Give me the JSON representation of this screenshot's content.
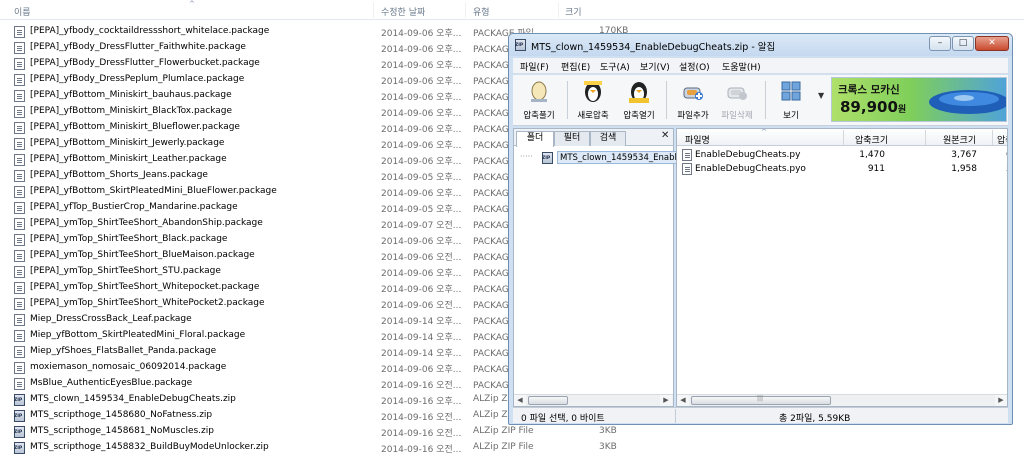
{
  "explorer": {
    "columns": {
      "name": "이름",
      "modified": "수정한 날짜",
      "type": "유형",
      "size": "크기"
    },
    "files": [
      {
        "name": "[PEPA]_yfbody_cocktaildressshort_whitelace.package",
        "date": "2014-09-06 오후...",
        "type": "PACKAGE 파일",
        "size": "170KB",
        "icon": "document-icon"
      },
      {
        "name": "[PEPA]_yfBody_DressFlutter_Faithwhite.package",
        "date": "2014-09-06 오후...",
        "type": "PACKAGE 파일",
        "size": "",
        "icon": "document-icon"
      },
      {
        "name": "[PEPA]_yfBody_DressFlutter_Flowerbucket.package",
        "date": "2014-09-06 오후...",
        "type": "PACKAGE 파일",
        "size": "",
        "icon": "document-icon"
      },
      {
        "name": "[PEPA]_yfBody_DressPeplum_Plumlace.package",
        "date": "2014-09-06 오후...",
        "type": "PACKAGE 파일",
        "size": "",
        "icon": "document-icon"
      },
      {
        "name": "[PEPA]_yfBottom_Miniskirt_bauhaus.package",
        "date": "2014-09-06 오후...",
        "type": "PACKAGE 파일",
        "size": "",
        "icon": "document-icon"
      },
      {
        "name": "[PEPA]_yfBottom_Miniskirt_BlackTox.package",
        "date": "2014-09-06 오후...",
        "type": "PACKAGE 파일",
        "size": "",
        "icon": "document-icon"
      },
      {
        "name": "[PEPA]_yfBottom_Miniskirt_Blueflower.package",
        "date": "2014-09-06 오후...",
        "type": "PACKAGE 파일",
        "size": "",
        "icon": "document-icon"
      },
      {
        "name": "[PEPA]_yfBottom_Miniskirt_Jewerly.package",
        "date": "2014-09-06 오후...",
        "type": "PACKAGE 파일",
        "size": "",
        "icon": "document-icon"
      },
      {
        "name": "[PEPA]_yfBottom_Miniskirt_Leather.package",
        "date": "2014-09-06 오후...",
        "type": "PACKAGE 파일",
        "size": "",
        "icon": "document-icon"
      },
      {
        "name": "[PEPA]_yfBottom_Shorts_Jeans.package",
        "date": "2014-09-05 오후...",
        "type": "PACKAGE 파일",
        "size": "",
        "icon": "document-icon"
      },
      {
        "name": "[PEPA]_yfBottom_SkirtPleatedMini_BlueFlower.package",
        "date": "2014-09-06 오후...",
        "type": "PACKAGE 파일",
        "size": "",
        "icon": "document-icon"
      },
      {
        "name": "[PEPA]_yfTop_BustierCrop_Mandarine.package",
        "date": "2014-09-05 오후...",
        "type": "PACKAGE 파일",
        "size": "",
        "icon": "document-icon"
      },
      {
        "name": "[PEPA]_ymTop_ShirtTeeShort_AbandonShip.package",
        "date": "2014-09-07 오전...",
        "type": "PACKAGE 파일",
        "size": "",
        "icon": "document-icon"
      },
      {
        "name": "[PEPA]_ymTop_ShirtTeeShort_Black.package",
        "date": "2014-09-06 오후...",
        "type": "PACKAGE 파일",
        "size": "",
        "icon": "document-icon"
      },
      {
        "name": "[PEPA]_ymTop_ShirtTeeShort_BlueMaison.package",
        "date": "2014-09-06 오전...",
        "type": "PACKAGE 파일",
        "size": "",
        "icon": "document-icon"
      },
      {
        "name": "[PEPA]_ymTop_ShirtTeeShort_STU.package",
        "date": "2014-09-06 오후...",
        "type": "PACKAGE 파일",
        "size": "",
        "icon": "document-icon"
      },
      {
        "name": "[PEPA]_ymTop_ShirtTeeShort_Whitepocket.package",
        "date": "2014-09-06 오후...",
        "type": "PACKAGE 파일",
        "size": "",
        "icon": "document-icon"
      },
      {
        "name": "[PEPA]_ymTop_ShirtTeeShort_WhitePocket2.package",
        "date": "2014-09-06 오전...",
        "type": "PACKAGE 파일",
        "size": "",
        "icon": "document-icon"
      },
      {
        "name": "Miep_DressCrossBack_Leaf.package",
        "date": "2014-09-14 오후...",
        "type": "PACKAGE 파일",
        "size": "",
        "icon": "document-icon"
      },
      {
        "name": "Miep_yfBottom_SkirtPleatedMini_Floral.package",
        "date": "2014-09-14 오후...",
        "type": "PACKAGE 파일",
        "size": "",
        "icon": "document-icon"
      },
      {
        "name": "Miep_yfShoes_FlatsBallet_Panda.package",
        "date": "2014-09-14 오후...",
        "type": "PACKAGE 파일",
        "size": "",
        "icon": "document-icon"
      },
      {
        "name": "moxiemason_nomosaic_06092014.package",
        "date": "2014-09-06 오후...",
        "type": "PACKAGE 파일",
        "size": "",
        "icon": "document-icon"
      },
      {
        "name": "MsBlue_AuthenticEyesBlue.package",
        "date": "2014-09-16 오전...",
        "type": "PACKAGE 파일",
        "size": "",
        "icon": "document-icon"
      },
      {
        "name": "MTS_clown_1459534_EnableDebugCheats.zip",
        "date": "2014-09-16 오후...",
        "type": "ALZip ZIP File",
        "size": "",
        "icon": "zip-icon"
      },
      {
        "name": "MTS_scripthoge_1458680_NoFatness.zip",
        "date": "2014-09-16 오전...",
        "type": "ALZip ZIP File",
        "size": "",
        "icon": "zip-icon"
      },
      {
        "name": "MTS_scripthoge_1458681_NoMuscles.zip",
        "date": "2014-09-16 오전...",
        "type": "ALZip ZIP File",
        "size": "3KB",
        "icon": "zip-icon"
      },
      {
        "name": "MTS_scripthoge_1458832_BuildBuyModeUnlocker.zip",
        "date": "2014-09-16 오전...",
        "type": "ALZip ZIP File",
        "size": "3KB",
        "icon": "zip-icon"
      }
    ]
  },
  "alzip": {
    "title": "MTS_clown_1459534_EnableDebugCheats.zip - 알집",
    "window_buttons": {
      "minimize": "–",
      "maximize": "□",
      "close": "✕"
    },
    "menu": [
      "파일(F)",
      "편집(E)",
      "도구(A)",
      "보기(V)",
      "설정(O)",
      "도움말(H)"
    ],
    "toolbar": [
      {
        "label": "압축풀기",
        "icon": "egg-extract-icon",
        "enabled": true
      },
      {
        "label": "새로압축",
        "icon": "penguin-new-archive-icon",
        "enabled": true
      },
      {
        "label": "압축열기",
        "icon": "penguin-open-archive-icon",
        "enabled": true
      },
      {
        "label": "파일추가",
        "icon": "add-file-icon",
        "enabled": true
      },
      {
        "label": "파일삭제",
        "icon": "delete-file-icon",
        "enabled": false
      },
      {
        "label": "보기",
        "icon": "view-grid-icon",
        "enabled": true
      }
    ],
    "view_dropdown_arrow": "▼",
    "ad": {
      "line1": "크록스 모카신",
      "price": "89,900",
      "won": "원"
    },
    "tabs": [
      "폴더",
      "필터",
      "검색"
    ],
    "pane_close": "✕",
    "tree_root": "MTS_clown_1459534_EnableDebugCheats.zip",
    "columns": {
      "name": "파일명",
      "compressed": "압축크기",
      "original": "원본크기",
      "ratio": "압축"
    },
    "files": [
      {
        "name": "EnableDebugCheats.py",
        "compressed": "1,470",
        "original": "3,767",
        "ratio": "6"
      },
      {
        "name": "EnableDebugCheats.pyo",
        "compressed": "911",
        "original": "1,958",
        "ratio": "5"
      }
    ],
    "scroll_arrows": {
      "left": "◀",
      "right": "▶"
    },
    "thumb_grip": "|||",
    "status": {
      "selection": "0 파일 선택, 0 바이트",
      "total": "총 2파일,  5.59KB"
    }
  }
}
